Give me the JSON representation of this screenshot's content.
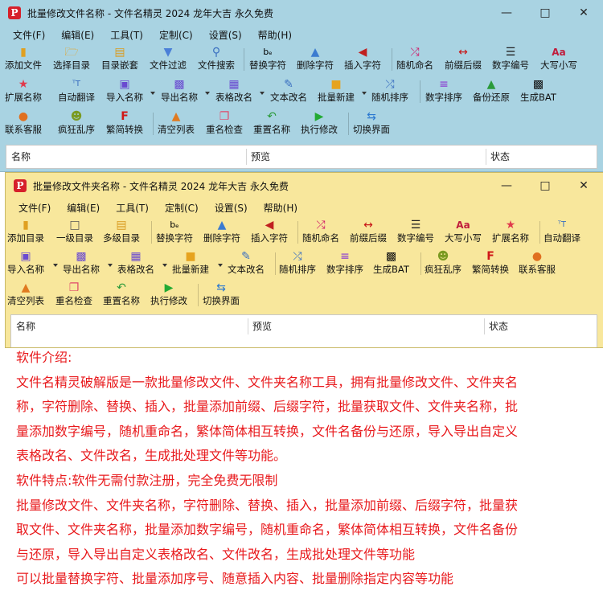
{
  "colors": {
    "window1_bg": "#a9d3e2",
    "window2_bg": "#f8e79c",
    "intro_text": "#e8191c",
    "app_icon": "#d6202a"
  },
  "window1": {
    "title": "批量修改文件名称 - 文件名精灵 2024 龙年大吉 永久免费",
    "menus": [
      "文件(F)",
      "编辑(E)",
      "工具(T)",
      "定制(C)",
      "设置(S)",
      "帮助(H)"
    ],
    "toolbar_row1": [
      "添加文件",
      "选择目录",
      "目录嵌套",
      "文件过滤",
      "文件搜索",
      "替换字符",
      "删除字符",
      "插入字符",
      "随机命名",
      "前缀后缀",
      "数字编号",
      "大写小写"
    ],
    "toolbar_row2": [
      "扩展名称",
      "自动翻译",
      "导入名称",
      "导出名称",
      "表格改名",
      "文本改名",
      "批量新建",
      "随机排序",
      "数字排序",
      "备份还原",
      "生成BAT"
    ],
    "toolbar_row3": [
      "联系客服",
      "疯狂乱序",
      "繁简转换",
      "清空列表",
      "重名检查",
      "重置名称",
      "执行修改",
      "切换界面"
    ],
    "columns": [
      "名称",
      "预览",
      "状态"
    ]
  },
  "window2": {
    "title": "批量修改文件夹名称 - 文件名精灵 2024 龙年大吉 永久免费",
    "menus": [
      "文件(F)",
      "编辑(E)",
      "工具(T)",
      "定制(C)",
      "设置(S)",
      "帮助(H)"
    ],
    "toolbar_row1": [
      "添加目录",
      "一级目录",
      "多级目录",
      "替换字符",
      "删除字符",
      "插入字符",
      "随机命名",
      "前缀后缀",
      "数字编号",
      "大写小写",
      "扩展名称",
      "自动翻译"
    ],
    "toolbar_row2": [
      "导入名称",
      "导出名称",
      "表格改名",
      "批量新建",
      "文本改名",
      "随机排序",
      "数字排序",
      "生成BAT",
      "疯狂乱序",
      "繁简转换",
      "联系客服"
    ],
    "toolbar_row3": [
      "清空列表",
      "重名检查",
      "重置名称",
      "执行修改",
      "切换界面"
    ],
    "columns": [
      "名称",
      "预览",
      "状态"
    ]
  },
  "intro": {
    "heading": "软件介绍:",
    "lines": [
      "文件名精灵破解版是一款批量修改文件、文件夹名称工具，拥有批量修改文件、文件夹名",
      "称，字符删除、替换、插入，批量添加前缀、后缀字符，批量获取文件、文件夹名称，批",
      "量添加数字编号，随机重命名，繁体简体相互转换，文件名备份与还原，导入导出自定义",
      "表格改名、文件改名，生成批处理文件等功能。",
      "软件特点:软件无需付款注册，完全免费无限制",
      "批量修改文件、文件夹名称，字符删除、替换、插入，批量添加前缀、后缀字符，批量获",
      "取文件、文件夹名称，批量添加数字编号，随机重命名，繁体简体相互转换，文件名备份",
      "与还原，导入导出自定义表格改名、文件改名，生成批处理文件等功能",
      "可以批量替换字符、批量添加序号、随意插入内容、批量删除指定内容等功能"
    ]
  }
}
